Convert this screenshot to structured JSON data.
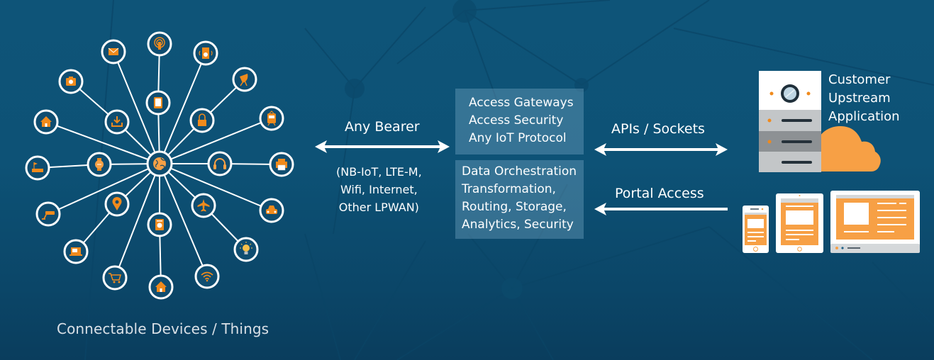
{
  "left_panel": {
    "caption": "Connectable Devices / Things",
    "hub": {
      "icon": "globe-icon"
    },
    "inner_devices": [
      {
        "icon": "tablet-icon"
      },
      {
        "icon": "lock-icon"
      },
      {
        "icon": "headphones-icon"
      },
      {
        "icon": "airplane-icon"
      },
      {
        "icon": "washing-machine-icon"
      },
      {
        "icon": "map-pin-icon"
      },
      {
        "icon": "smartwatch-icon"
      },
      {
        "icon": "download-icon"
      }
    ],
    "outer_devices": [
      {
        "icon": "broadcast-antenna-icon"
      },
      {
        "icon": "speaker-icon"
      },
      {
        "icon": "satellite-dish-icon"
      },
      {
        "icon": "train-icon"
      },
      {
        "icon": "printer-icon"
      },
      {
        "icon": "car-icon"
      },
      {
        "icon": "light-bulb-icon"
      },
      {
        "icon": "wifi-icon"
      },
      {
        "icon": "smart-home-icon"
      },
      {
        "icon": "shopping-cart-icon"
      },
      {
        "icon": "laptop-icon"
      },
      {
        "icon": "security-camera-icon"
      },
      {
        "icon": "router-icon"
      },
      {
        "icon": "house-icon"
      },
      {
        "icon": "camera-icon"
      },
      {
        "icon": "mail-icon"
      }
    ]
  },
  "bearer": {
    "title": "Any Bearer",
    "options": [
      "(NB-IoT, LTE-M,",
      "Wifi, Internet,",
      "Other LPWAN)"
    ],
    "arrow": "bidirectional"
  },
  "platform": {
    "access_box": [
      "Access Gateways",
      "Access Security",
      "Any IoT Protocol"
    ],
    "data_box": [
      "Data Orchestration",
      "Transformation,",
      "Routing, Storage,",
      "Analytics, Security"
    ]
  },
  "upstream": {
    "link_label": "APIs / Sockets",
    "arrow": "bidirectional",
    "target_lines": [
      "Customer",
      "Upstream",
      "Application"
    ],
    "icons": [
      "server-icon",
      "cloud-icon"
    ]
  },
  "portal": {
    "link_label": "Portal Access",
    "arrow": "left",
    "devices": [
      "smartphone-icon",
      "tablet-icon",
      "desktop-monitor-icon"
    ]
  },
  "colors": {
    "background": "#0d5276",
    "accent_orange": "#f7a045",
    "icon_orange": "#f08a1c",
    "node_ring": "#ffffff",
    "box_fill": "#3b7797"
  }
}
